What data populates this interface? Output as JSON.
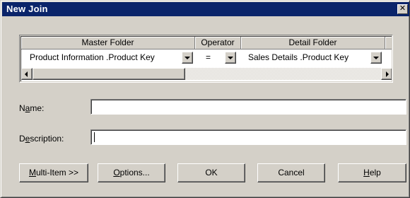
{
  "window": {
    "title": "New Join",
    "close_glyph": "✕"
  },
  "grid": {
    "columns": [
      "Master Folder",
      "Operator",
      "Detail Folder"
    ],
    "row": {
      "master_folder": "Product Information .Product Key",
      "operator": "=",
      "detail_folder": "Sales Details .Product Key"
    }
  },
  "form": {
    "name_label_pre": "N",
    "name_label_ul": "a",
    "name_label_post": "me:",
    "name_value": "",
    "description_label_pre": "D",
    "description_label_ul": "e",
    "description_label_post": "scription:",
    "description_value": ""
  },
  "buttons": {
    "multi_item_ul": "M",
    "multi_item_rest": "ulti-Item >>",
    "options_ul": "O",
    "options_rest": "ptions...",
    "ok": "OK",
    "cancel": "Cancel",
    "help_ul": "H",
    "help_rest": "elp"
  },
  "icons": {
    "dropdown": "chevron-down-icon",
    "scroll_left": "arrow-left-icon",
    "scroll_right": "arrow-right-icon",
    "close": "close-icon"
  },
  "colors": {
    "titlebar": "#0a246a",
    "face": "#d4d0c8",
    "field": "#ffffff"
  }
}
